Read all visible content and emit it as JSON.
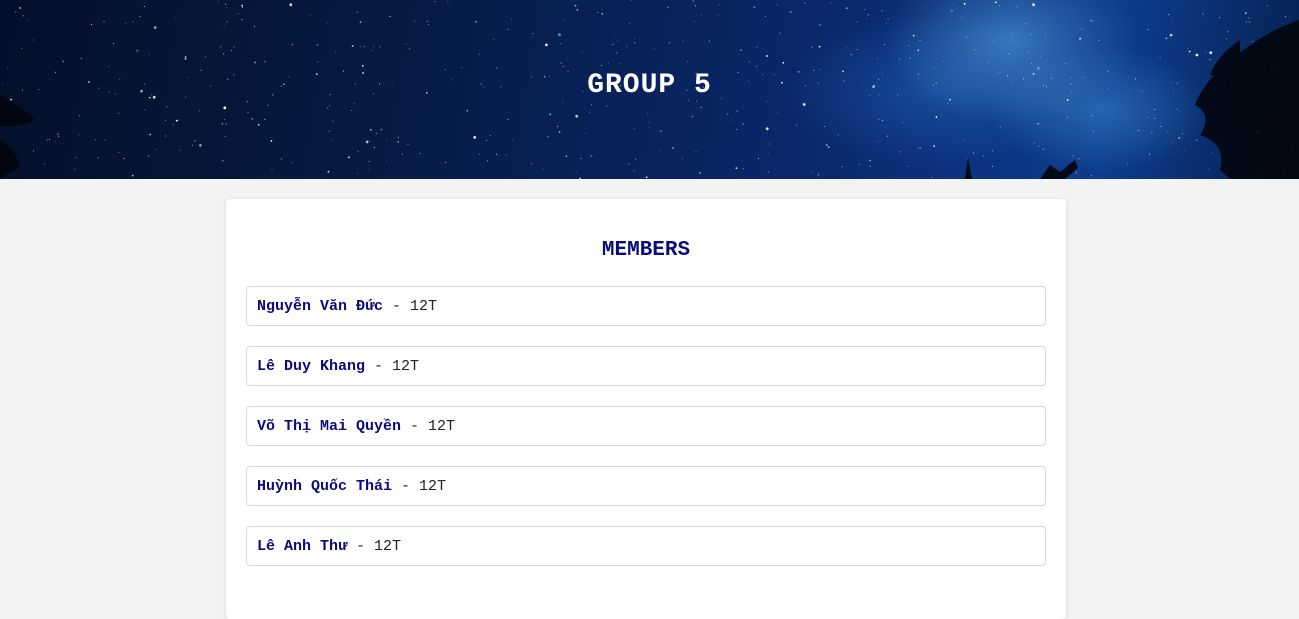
{
  "header": {
    "title": "GROUP 5"
  },
  "members_card": {
    "title": "MEMBERS",
    "members": [
      {
        "name": "Nguyễn Văn Đức",
        "separator": " - ",
        "class": "12T"
      },
      {
        "name": "Lê Duy Khang",
        "separator": " - ",
        "class": "12T"
      },
      {
        "name": "Võ Thị Mai Quyền",
        "separator": " - ",
        "class": "12T"
      },
      {
        "name": "Huỳnh Quốc Thái",
        "separator": " - ",
        "class": "12T"
      },
      {
        "name": "Lê Anh Thư",
        "separator": " - ",
        "class": "12T"
      }
    ]
  },
  "colors": {
    "page_background": "#f3f3f3",
    "banner_sky": "#0a2a6e",
    "accent_text": "#0b0b7a"
  }
}
